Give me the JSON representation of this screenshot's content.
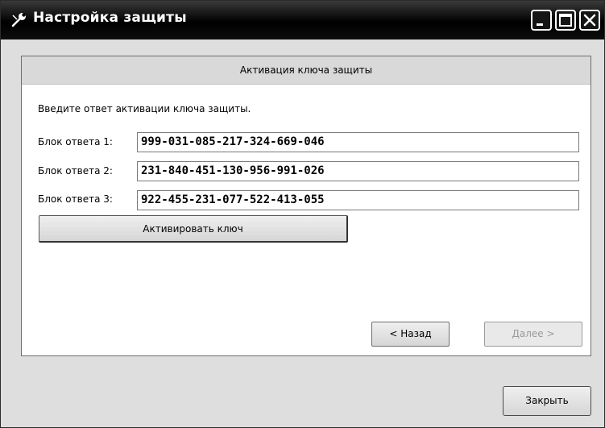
{
  "window": {
    "title": "Настройка защиты",
    "icon": "wrench-icon",
    "controls": [
      "minimize-icon",
      "maximize-icon",
      "close-icon"
    ]
  },
  "panel": {
    "header": "Активация ключа защиты",
    "instruction": "Введите ответ активации ключа защиты.",
    "rows": [
      {
        "label": "Блок ответа 1:",
        "value": "999-031-085-217-324-669-046"
      },
      {
        "label": "Блок ответа 2:",
        "value": "231-840-451-130-956-991-026"
      },
      {
        "label": "Блок ответа 3:",
        "value": "922-455-231-077-522-413-055"
      }
    ],
    "activate_label": "Активировать ключ",
    "back_label": "< Назад",
    "next_label": "Далее >"
  },
  "footer": {
    "close_label": "Закрыть"
  }
}
